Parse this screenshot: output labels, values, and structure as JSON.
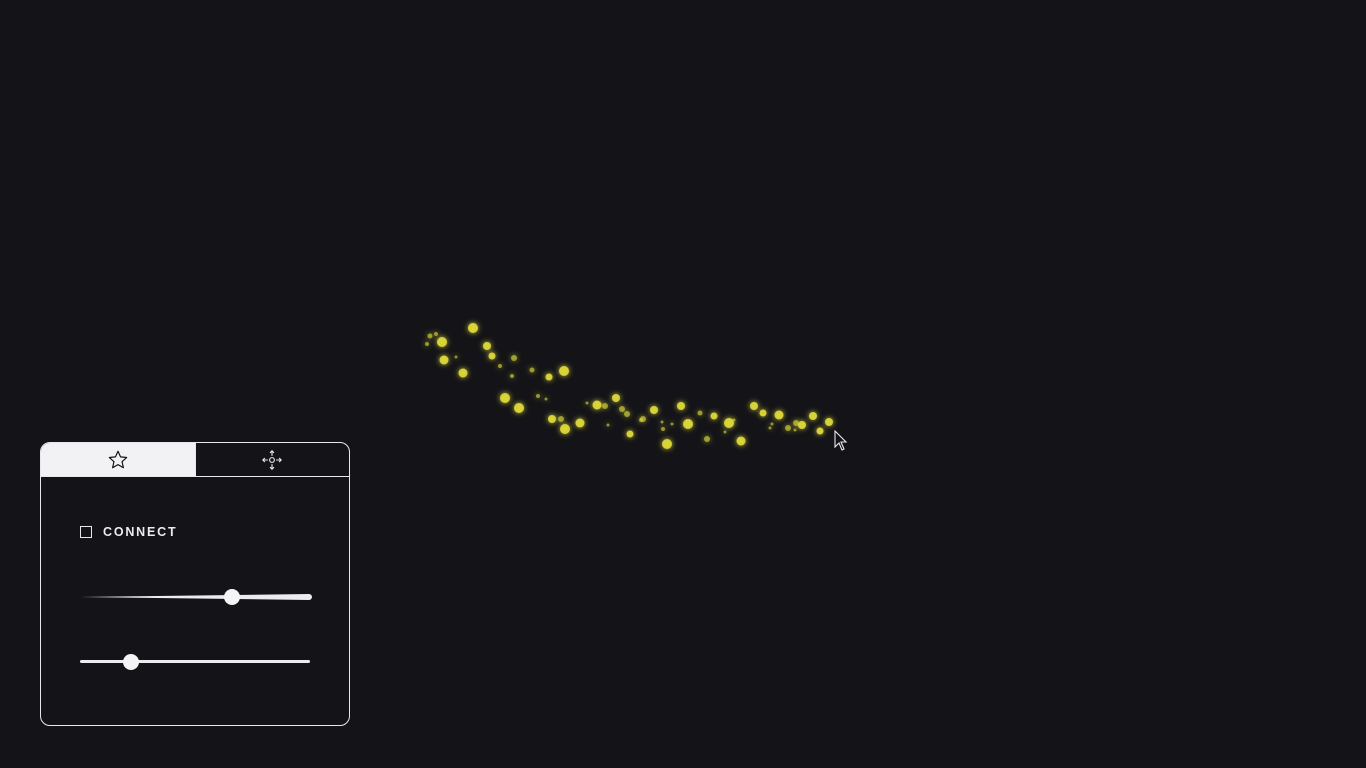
{
  "panel": {
    "tabs": [
      {
        "icon": "star-icon",
        "active": true
      },
      {
        "icon": "move-arrows-icon",
        "active": false
      }
    ],
    "connect": {
      "label": "CONNECT",
      "checked": false
    },
    "sliders": [
      {
        "value": 0.65
      },
      {
        "value": 0.22
      }
    ]
  },
  "colors": {
    "background": "#141418",
    "particle": "#e0dc3a",
    "panel_border": "#e8e8ea"
  }
}
